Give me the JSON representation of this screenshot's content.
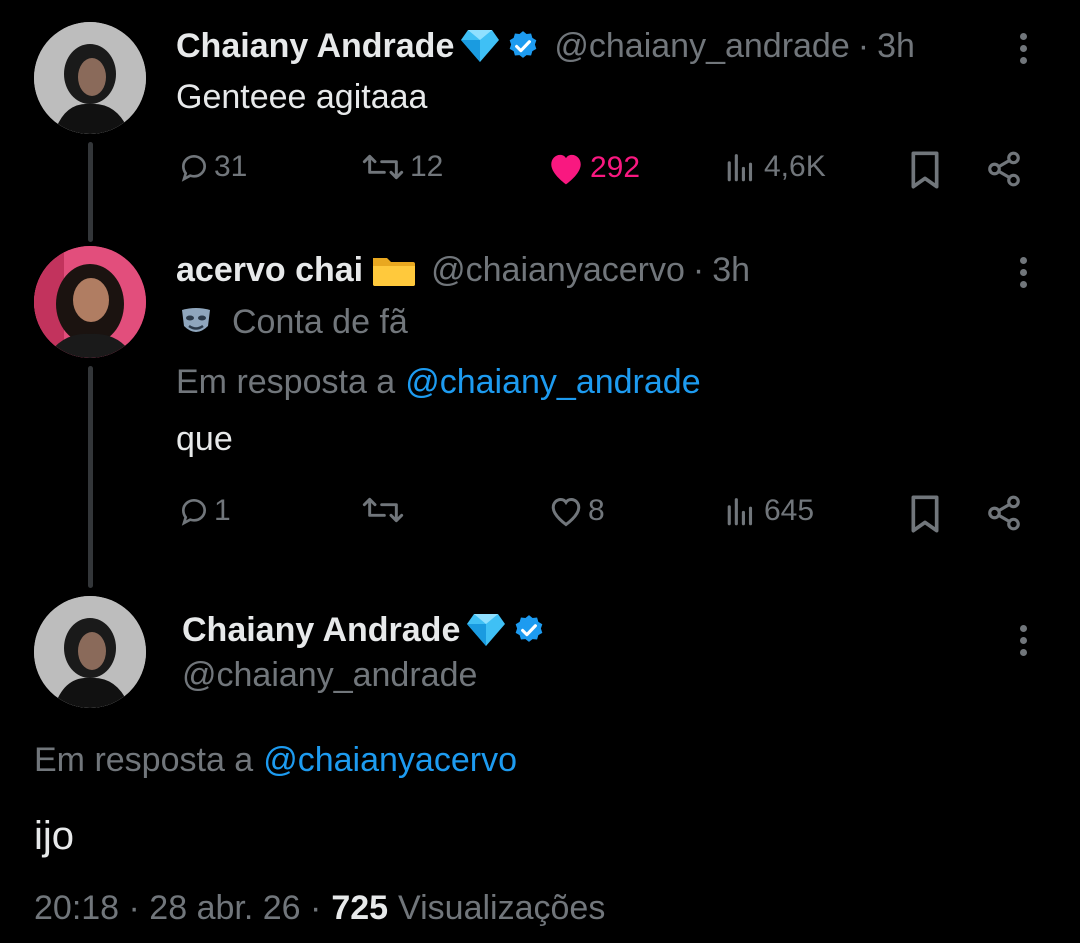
{
  "tweets": [
    {
      "author": "Chaiany Andrade",
      "handle": "@chaiany_andrade",
      "time": "3h",
      "text": "Genteee agitaaa",
      "actions": {
        "replies": "31",
        "retweets": "12",
        "likes": "292",
        "views": "4,6K"
      }
    },
    {
      "author": "acervo chai",
      "handle": "@chaianyacervo",
      "time": "3h",
      "label": "Conta de fã",
      "reply_prefix": "Em resposta a",
      "reply_to": "@chaiany_andrade",
      "text": "que",
      "actions": {
        "replies": "1",
        "retweets": "",
        "likes": "8",
        "views": "645"
      }
    }
  ],
  "main_tweet": {
    "author": "Chaiany Andrade",
    "handle": "@chaiany_andrade",
    "reply_prefix": "Em resposta a",
    "reply_to": "@chaianyacervo",
    "text": "ijo",
    "timestamp": "20:18 · 28 abr. 26 ·",
    "views_count": "725",
    "views_label": "Visualizações"
  },
  "colors": {
    "background": "#000000",
    "text": "#e7e9ea",
    "muted": "#71767b",
    "link": "#1d9bf0",
    "like": "#f91880",
    "verified": "#1d9bf0"
  }
}
